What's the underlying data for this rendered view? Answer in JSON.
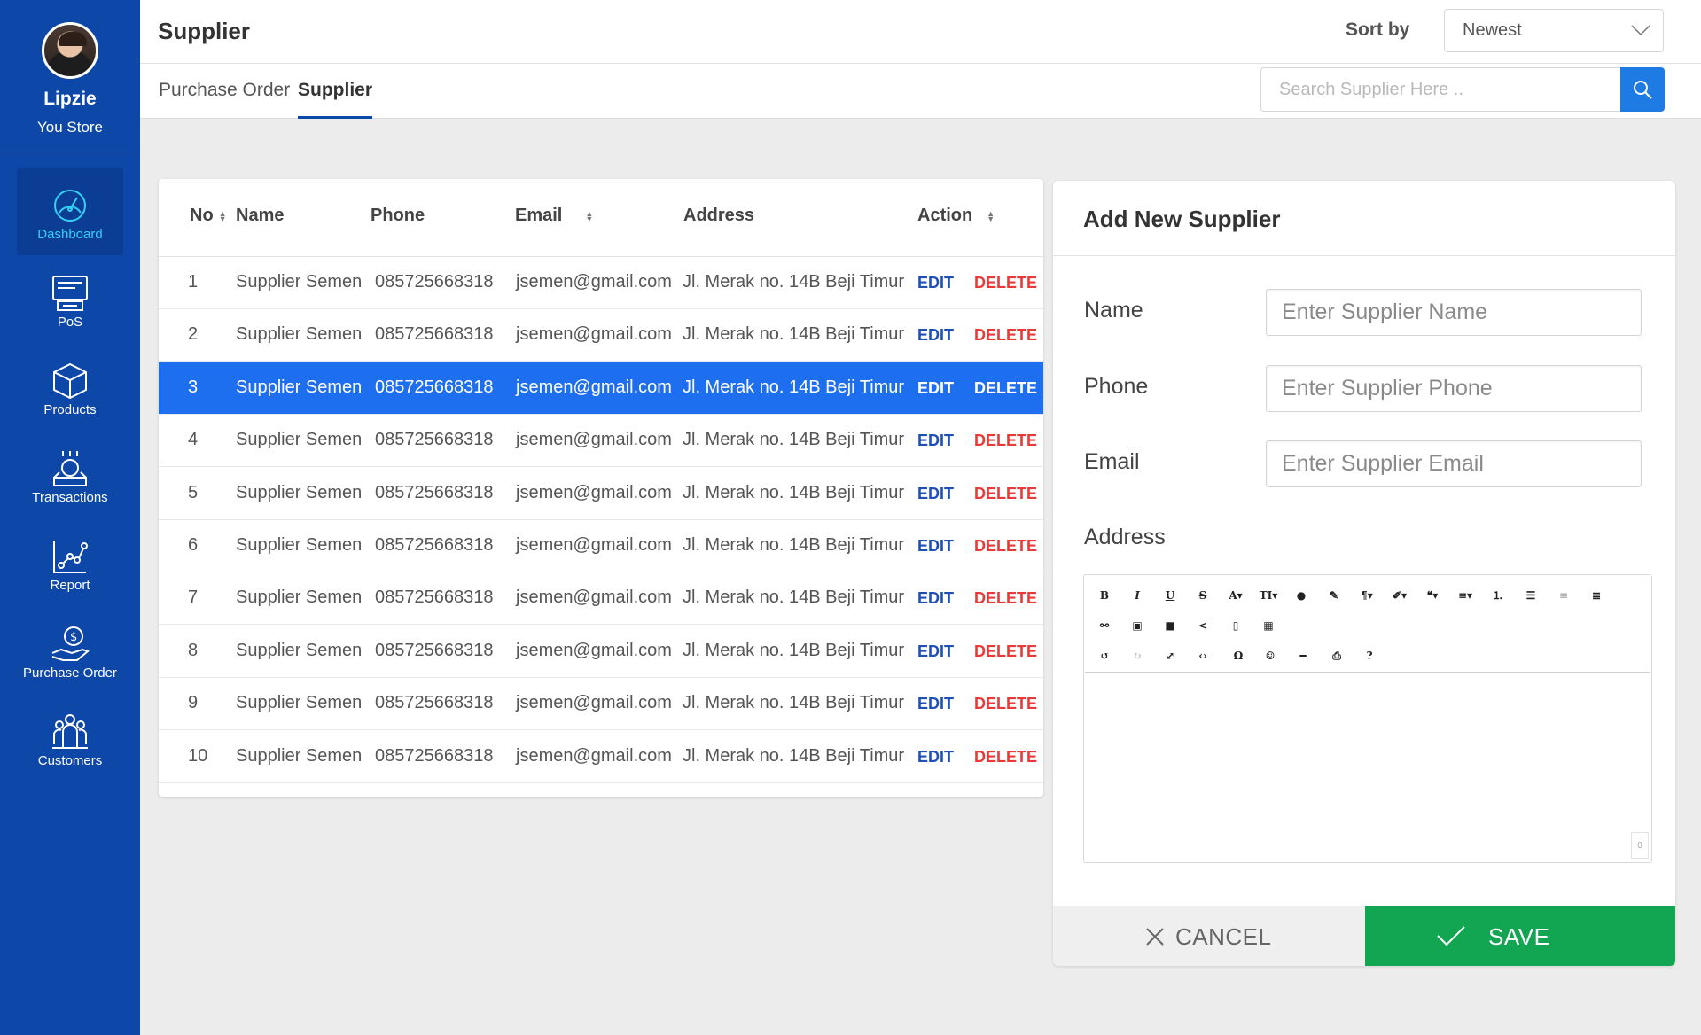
{
  "profile": {
    "name": "Lipzie",
    "store": "You Store"
  },
  "nav": [
    {
      "label": "Dashboard",
      "icon": "dashboard-gauge-icon",
      "active": true
    },
    {
      "label": "PoS",
      "icon": "pos-terminal-icon"
    },
    {
      "label": "Products",
      "icon": "box-icon"
    },
    {
      "label": "Transactions",
      "icon": "transactions-icon"
    },
    {
      "label": "Report",
      "icon": "report-chart-icon"
    },
    {
      "label": "Purchase Order",
      "icon": "purchase-order-icon"
    },
    {
      "label": "Customers",
      "icon": "customers-icon"
    }
  ],
  "header": {
    "title": "Supplier",
    "sort_label": "Sort by",
    "sort_value": "Newest",
    "tabs": [
      {
        "label": "Purchase Order"
      },
      {
        "label": "Supplier",
        "active": true
      }
    ],
    "search_placeholder": "Search Supplier Here .."
  },
  "table": {
    "columns": {
      "no": "No",
      "name": "Name",
      "phone": "Phone",
      "email": "Email",
      "address": "Address",
      "action": "Action"
    },
    "edit_label": "EDIT",
    "delete_label": "DELETE",
    "selected_row": 3,
    "rows": [
      {
        "no": "1",
        "name": "Supplier Semen",
        "phone": "085725668318",
        "email": "jsemen@gmail.com",
        "address": "Jl. Merak no. 14B Beji Timur"
      },
      {
        "no": "2",
        "name": "Supplier Semen",
        "phone": "085725668318",
        "email": "jsemen@gmail.com",
        "address": "Jl. Merak no. 14B Beji Timur"
      },
      {
        "no": "3",
        "name": "Supplier Semen",
        "phone": "085725668318",
        "email": "jsemen@gmail.com",
        "address": "Jl. Merak no. 14B Beji Timur"
      },
      {
        "no": "4",
        "name": "Supplier Semen",
        "phone": "085725668318",
        "email": "jsemen@gmail.com",
        "address": "Jl. Merak no. 14B Beji Timur"
      },
      {
        "no": "5",
        "name": "Supplier Semen",
        "phone": "085725668318",
        "email": "jsemen@gmail.com",
        "address": "Jl. Merak no. 14B Beji Timur"
      },
      {
        "no": "6",
        "name": "Supplier Semen",
        "phone": "085725668318",
        "email": "jsemen@gmail.com",
        "address": "Jl. Merak no. 14B Beji Timur"
      },
      {
        "no": "7",
        "name": "Supplier Semen",
        "phone": "085725668318",
        "email": "jsemen@gmail.com",
        "address": "Jl. Merak no. 14B Beji Timur"
      },
      {
        "no": "8",
        "name": "Supplier Semen",
        "phone": "085725668318",
        "email": "jsemen@gmail.com",
        "address": "Jl. Merak no. 14B Beji Timur"
      },
      {
        "no": "9",
        "name": "Supplier Semen",
        "phone": "085725668318",
        "email": "jsemen@gmail.com",
        "address": "Jl. Merak no. 14B Beji Timur"
      },
      {
        "no": "10",
        "name": "Supplier Semen",
        "phone": "085725668318",
        "email": "jsemen@gmail.com",
        "address": "Jl. Merak no. 14B Beji Timur"
      }
    ]
  },
  "form": {
    "title": "Add New Supplier",
    "name_label": "Name",
    "name_placeholder": "Enter Supplier Name",
    "phone_label": "Phone",
    "phone_placeholder": "Enter Supplier Phone",
    "email_label": "Email",
    "email_placeholder": "Enter Supplier Email",
    "address_label": "Address",
    "char_count": "0",
    "cancel_label": "CANCEL",
    "save_label": "SAVE"
  },
  "colors": {
    "sidebar": "#0d47a8",
    "accent": "#1e6ef0",
    "save": "#12a552",
    "delete": "#e83a3a",
    "active_nav": "#34d0f4"
  }
}
